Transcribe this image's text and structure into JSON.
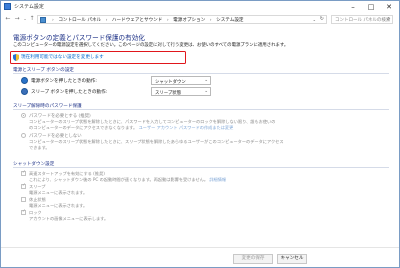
{
  "window": {
    "title": "システム設定"
  },
  "address": {
    "crumbs": [
      "コントロール パネル",
      "ハードウェアとサウンド",
      "電源オプション",
      "システム設定"
    ],
    "search_placeholder": "コントロール パネルの検索"
  },
  "page": {
    "heading": "電源ボタンの定義とパスワード保護の有効化",
    "description": "このコンピューターの電源設定を選択してください。このページの設定に対して行う変更は、お使いのすべての電源プランに適用されます。",
    "change_link": "現在利用可能ではない設定を変更します"
  },
  "power_section": {
    "title": "電源とスリープ ボタンの設定",
    "rows": [
      {
        "label": "電源ボタンを押したときの動作:",
        "value": "シャットダウン"
      },
      {
        "label": "スリープ ボタンを押したときの動作:",
        "value": "スリープ状態"
      }
    ]
  },
  "password_section": {
    "title": "スリープ解除時のパスワード保護",
    "option1": {
      "label": "パスワードを必要とする (推奨)",
      "desc1": "コンピューターのスリープ状態を解除したときに、パスワードを入力してコンピューターのロックを解除しない限り、誰もお使いの",
      "desc2": "のコンピューターのデータにアクセスできなくなります。",
      "link": "ユーザー アカウント パスワードの作成または変更"
    },
    "option2": {
      "label": "パスワードを必要としない",
      "desc1": "コンピューターのスリープ状態を解除したときに、スリープ状態を解除したあらゆるユーザーがこのコンピューターのデータにアクセス",
      "desc2": "できます。"
    }
  },
  "shutdown_section": {
    "title": "シャットダウン設定",
    "items": [
      {
        "label": "高速スタートアップを有効にする (推奨)",
        "desc": "これにより、シャットダウン後の PC の起動時間が速くなります。再起動は影響を受けません。",
        "link": "詳細情報"
      },
      {
        "label": "スリープ",
        "desc": "電源メニューに表示されます。"
      },
      {
        "label": "休止状態",
        "desc": "電源メニューに表示されます。"
      },
      {
        "label": "ロック",
        "desc": "アカウントの画像メニューに表示します。"
      }
    ]
  },
  "buttons": {
    "save": "変更の保存",
    "cancel": "キャンセル"
  },
  "colors": {
    "accent_red": "#e0161b",
    "heading_blue": "#1e3287",
    "link_blue": "#0066cc"
  }
}
